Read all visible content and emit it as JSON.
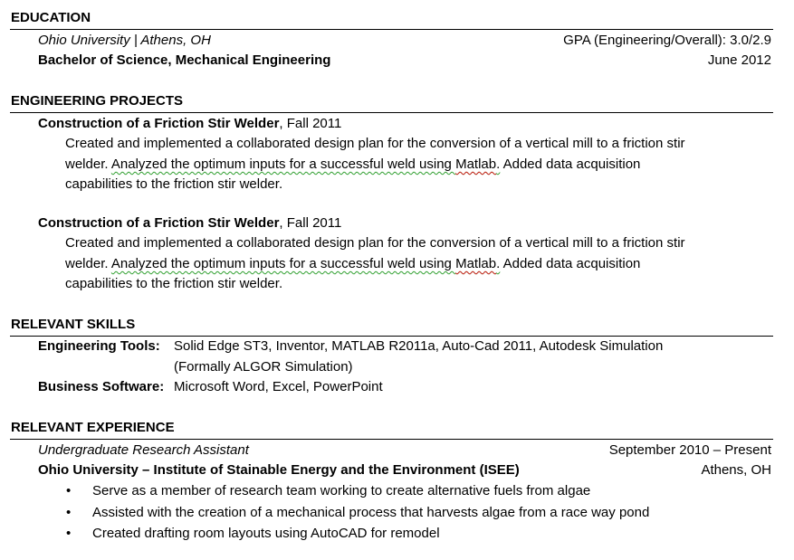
{
  "education": {
    "heading": "EDUCATION",
    "institution": "Ohio University  | Athens, OH",
    "gpa": "GPA (Engineering/Overall):  3.0/2.9",
    "degree": "Bachelor of Science, Mechanical Engineering",
    "date": "June 2012"
  },
  "projects": {
    "heading": "ENGINEERING PROJECTS",
    "items": [
      {
        "title": "Construction of a Friction Stir Welder",
        "term": ", Fall 2011",
        "line1": "Created and implemented  a collaborated design plan for the conversion of a vertical mill to a friction stir",
        "line2_a": "welder. ",
        "line2_b": "Analyzed the optimum inputs for a successful weld using ",
        "line2_c": "Matlab",
        "line2_d": ".",
        "line2_e": " Added data acquisition",
        "line3": "capabilities to the friction stir welder."
      },
      {
        "title": "Construction of a Friction Stir Welder",
        "term": ", Fall 2011",
        "line1": "Created and implemented  a collaborated design plan for the conversion of a vertical mill to a friction stir",
        "line2_a": "welder. ",
        "line2_b": "Analyzed the optimum inputs for a successful weld using ",
        "line2_c": "Matlab",
        "line2_d": ".",
        "line2_e": " Added data acquisition",
        "line3": "capabilities to the friction stir welder."
      }
    ]
  },
  "skills": {
    "heading": "RELEVANT SKILLS",
    "engineering_label": "Engineering Tools:",
    "engineering_line1": "Solid Edge ST3, Inventor, MATLAB R2011a, Auto-Cad 2011, Autodesk Simulation",
    "engineering_line2": "(Formally ALGOR Simulation)",
    "business_label": "Business Software:",
    "business_value": "Microsoft Word, Excel, PowerPoint"
  },
  "experience": {
    "heading": "RELEVANT EXPERIENCE",
    "role": "Undergraduate  Research Assistant",
    "dates": "September  2010 – Present",
    "organization": "Ohio University – Institute of Stainable Energy and the Environment (ISEE)",
    "location": "Athens,  OH",
    "bullet_glyph": "•",
    "bullets": [
      "Serve as a member of research team working to create alternative fuels from algae",
      "Assisted with the creation of a mechanical process that harvests algae from a race way pond",
      "Created drafting room layouts using AutoCAD for remodel"
    ]
  }
}
